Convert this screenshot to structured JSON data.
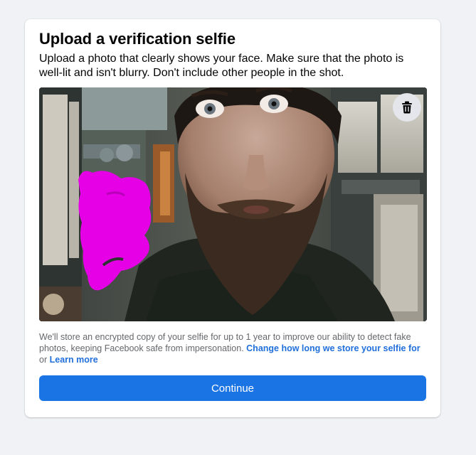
{
  "dialog": {
    "title": "Upload a verification selfie",
    "subtitle": "Upload a photo that clearly shows your face. Make sure that the photo is well-lit and isn't blurry. Don't include other people in the shot.",
    "photo": {
      "description_icon": "selfie-photo",
      "delete_icon": "trash-icon"
    },
    "legal": {
      "text": "We'll store an encrypted copy of your selfie for up to 1 year to improve our ability to detect fake photos, keeping Facebook safe from impersonation.",
      "link_change": "Change how long we store your selfie for",
      "or": "or",
      "link_learn": "Learn more"
    },
    "continue_label": "Continue"
  },
  "colors": {
    "page_bg": "#f0f2f5",
    "card_bg": "#ffffff",
    "primary": "#1b74e4",
    "link": "#216fdb",
    "secondary_text": "#65676b",
    "magenta_redaction": "#e600e6"
  }
}
